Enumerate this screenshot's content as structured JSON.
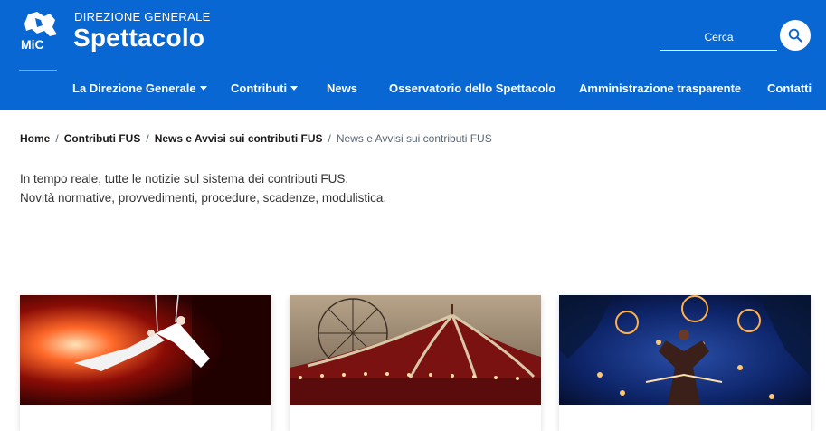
{
  "header": {
    "logo_text": "MiC",
    "subtitle": "DIREZIONE GENERALE",
    "title": "Spettacolo",
    "search_placeholder": "Cerca",
    "search_icon": "search-icon",
    "background": "#0867d2"
  },
  "nav": {
    "items": [
      {
        "label": "La Direzione Generale",
        "has_dropdown": true
      },
      {
        "label": "Contributi",
        "has_dropdown": true
      },
      {
        "label": "News",
        "has_dropdown": false
      },
      {
        "label": "Osservatorio dello Spettacolo",
        "has_dropdown": false
      },
      {
        "label": "Amministrazione trasparente",
        "has_dropdown": false
      },
      {
        "label": "Contatti",
        "has_dropdown": false
      }
    ]
  },
  "breadcrumb": {
    "items": [
      "Home",
      "Contributi FUS",
      "News e Avvisi sui contributi FUS"
    ],
    "current": "News e Avvisi sui contributi FUS",
    "separator": "/"
  },
  "intro": {
    "line1": "In tempo reale, tutte le notizie sul sistema dei contributi FUS.",
    "line2": "Novità normative, provvedimenti, procedure, scadenze, modulistica."
  },
  "cards": [
    {
      "image": "aerial-acrobats-photo"
    },
    {
      "image": "circus-tent-photo"
    },
    {
      "image": "fire-acrobats-photo"
    }
  ]
}
